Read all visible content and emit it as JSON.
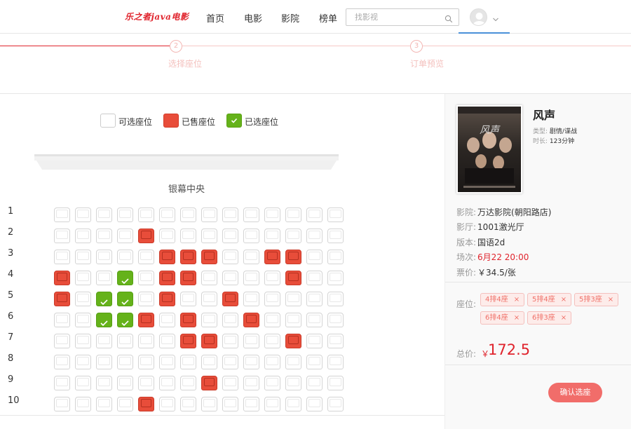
{
  "header": {
    "logo": "乐之者java电影",
    "nav": [
      "首页",
      "电影",
      "影院",
      "榜单"
    ],
    "search_placeholder": "找影视"
  },
  "steps": [
    {
      "number": "2",
      "label": "选择座位"
    },
    {
      "number": "3",
      "label": "订单预览"
    }
  ],
  "legend": {
    "available": "可选座位",
    "sold": "已售座位",
    "selected": "已选座位"
  },
  "screen_label": "银幕中央",
  "seat_map": {
    "row_labels": [
      "1",
      "2",
      "3",
      "4",
      "5",
      "6",
      "7",
      "8",
      "9",
      "10"
    ],
    "columns": 14,
    "rows": [
      [
        "a",
        "a",
        "a",
        "a",
        "a",
        "a",
        "a",
        "a",
        "a",
        "a",
        "a",
        "a",
        "a",
        "a"
      ],
      [
        "a",
        "a",
        "a",
        "a",
        "s",
        "a",
        "a",
        "a",
        "a",
        "a",
        "a",
        "a",
        "a",
        "a"
      ],
      [
        "a",
        "a",
        "a",
        "a",
        "a",
        "s",
        "s",
        "s",
        "a",
        "a",
        "s",
        "s",
        "a",
        "a"
      ],
      [
        "s",
        "a",
        "a",
        "x",
        "a",
        "s",
        "s",
        "a",
        "a",
        "a",
        "a",
        "s",
        "a",
        "a"
      ],
      [
        "s",
        "a",
        "x",
        "x",
        "a",
        "s",
        "a",
        "a",
        "s",
        "a",
        "a",
        "a",
        "a",
        "a"
      ],
      [
        "a",
        "a",
        "x",
        "x",
        "s",
        "a",
        "s",
        "a",
        "a",
        "s",
        "a",
        "a",
        "a",
        "a"
      ],
      [
        "a",
        "a",
        "a",
        "a",
        "a",
        "a",
        "s",
        "s",
        "a",
        "a",
        "a",
        "s",
        "a",
        "a"
      ],
      [
        "a",
        "a",
        "a",
        "a",
        "a",
        "a",
        "a",
        "a",
        "a",
        "a",
        "a",
        "a",
        "a",
        "a"
      ],
      [
        "a",
        "a",
        "a",
        "a",
        "a",
        "a",
        "a",
        "s",
        "a",
        "a",
        "a",
        "a",
        "a",
        "a"
      ],
      [
        "a",
        "a",
        "a",
        "a",
        "s",
        "a",
        "a",
        "a",
        "a",
        "a",
        "a",
        "a",
        "a",
        "a"
      ]
    ]
  },
  "movie": {
    "title": "风声",
    "type_label": "类型:",
    "type_value": "剧情/谍战",
    "duration_label": "时长:",
    "duration_value": "123分钟"
  },
  "order": {
    "cinema_label": "影院:",
    "cinema": "万达影院(朝阳路店)",
    "hall_label": "影厅:",
    "hall": "1001激光厅",
    "version_label": "版本:",
    "version": "国语2d",
    "session_label": "场次:",
    "session": "6月22 20:00",
    "price_label": "票价:",
    "price": "￥34.5/张",
    "seats_label": "座位:",
    "seats": [
      "4排4座",
      "5排4座",
      "5排3座",
      "6排4座",
      "6排3座"
    ],
    "total_label": "总价:",
    "currency": "￥",
    "total": "172.5",
    "confirm": "确认选座"
  },
  "colors": {
    "brand_red": "#e0242d",
    "sold": "#e84d3a",
    "selected": "#65b21a",
    "confirm": "#f16d6a"
  }
}
